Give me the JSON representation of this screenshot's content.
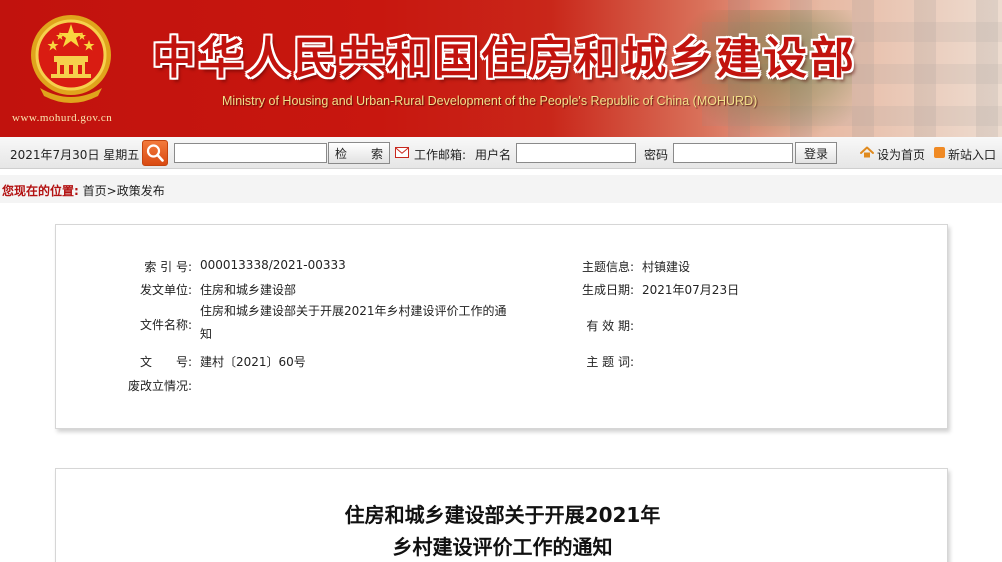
{
  "header": {
    "site_title": "中华人民共和国住房和城乡建设部",
    "site_subtitle": "Ministry of Housing and Urban-Rural Development of the People's Republic of China (MOHURD)",
    "site_url": "www.mohurd.gov.cn",
    "emblem_icon": "national-emblem-icon",
    "brand_red": "#c2130e"
  },
  "toolbar": {
    "date": "2021年7月30日 星期五",
    "search_icon": "magnifier-icon",
    "search_value": "",
    "search_button": "检　　索",
    "mail_icon": "mail-icon",
    "mail_label": "工作邮箱:",
    "username_label": "用户名",
    "username_value": "",
    "password_label": "密码",
    "password_value": "",
    "login_button": "登录",
    "set_home": "设为首页",
    "new_site": "新站入口"
  },
  "breadcrumb": {
    "lead": "您现在的位置:",
    "home": "首页",
    "sep": ">",
    "current": "政策发布"
  },
  "info": {
    "index_no_label": "索 引 号:",
    "index_no": "000013338/2021-00333",
    "topic_label": "主题信息:",
    "topic": "村镇建设",
    "issuer_label": "发文单位:",
    "issuer": "住房和城乡建设部",
    "date_label": "生成日期:",
    "date": "2021年07月23日",
    "doc_name_label": "文件名称:",
    "doc_name": "住房和城乡建设部关于开展2021年乡村建设评价工作的通知",
    "validity_label": "有 效 期:",
    "validity": "",
    "doc_no_label": "文　　号:",
    "doc_no": "建村〔2021〕60号",
    "keywords_label": "主 题 词:",
    "keywords": "",
    "status_label": "废改立情况:",
    "status": ""
  },
  "article": {
    "title_line1": "住房和城乡建设部关于开展2021年",
    "title_line2": "乡村建设评价工作的通知"
  }
}
